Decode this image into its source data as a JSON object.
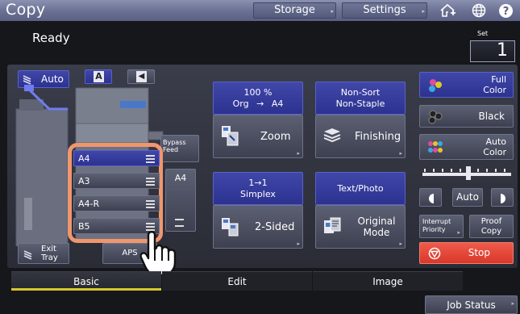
{
  "header": {
    "title": "Copy",
    "storage_label": "Storage",
    "settings_label": "Settings",
    "icons": [
      "home-plus-icon",
      "globe-icon",
      "help-icon"
    ]
  },
  "status": {
    "text": "Ready",
    "set_label": "Set",
    "set_value": "1"
  },
  "left": {
    "auto_label": "Auto",
    "mode_a": "A",
    "mode_b": "◀",
    "bypass_label_1": "Bypass",
    "bypass_label_2": "Feed",
    "bypass_size": "A4",
    "exit_tray_1": "Exit",
    "exit_tray_2": "Tray",
    "aps_label": "APS",
    "trays": [
      "A4",
      "A3",
      "A4-R",
      "B5"
    ],
    "selected_tray": "A4"
  },
  "center": {
    "zoom_percent": "100 %",
    "zoom_org": "Org",
    "zoom_arrow": "→",
    "zoom_size": "A4",
    "zoom_button": "Zoom",
    "finish_line1": "Non-Sort",
    "finish_line2": "Non-Staple",
    "finishing_button": "Finishing",
    "duplex_line1": "1→1",
    "duplex_line2": "Simplex",
    "two_sided_button": "2-Sided",
    "original_type": "Text/Photo",
    "original_line1": "Original",
    "original_line2": "Mode"
  },
  "right": {
    "full_color_1": "Full",
    "full_color_2": "Color",
    "black": "Black",
    "auto_color_1": "Auto",
    "auto_color_2": "Color",
    "density_auto": "Auto",
    "interrupt_1": "Interrupt",
    "interrupt_2": "Priority",
    "proof_1": "Proof",
    "proof_2": "Copy",
    "stop": "Stop"
  },
  "tabs": [
    "Basic",
    "Edit",
    "Image"
  ],
  "active_tab": "Basic",
  "job_status": "Job Status",
  "colors": {
    "accent_blue": "#3038a0",
    "stop_red": "#e5483a",
    "highlight": "#f0966e",
    "tab_underline": "#d6c52c"
  }
}
